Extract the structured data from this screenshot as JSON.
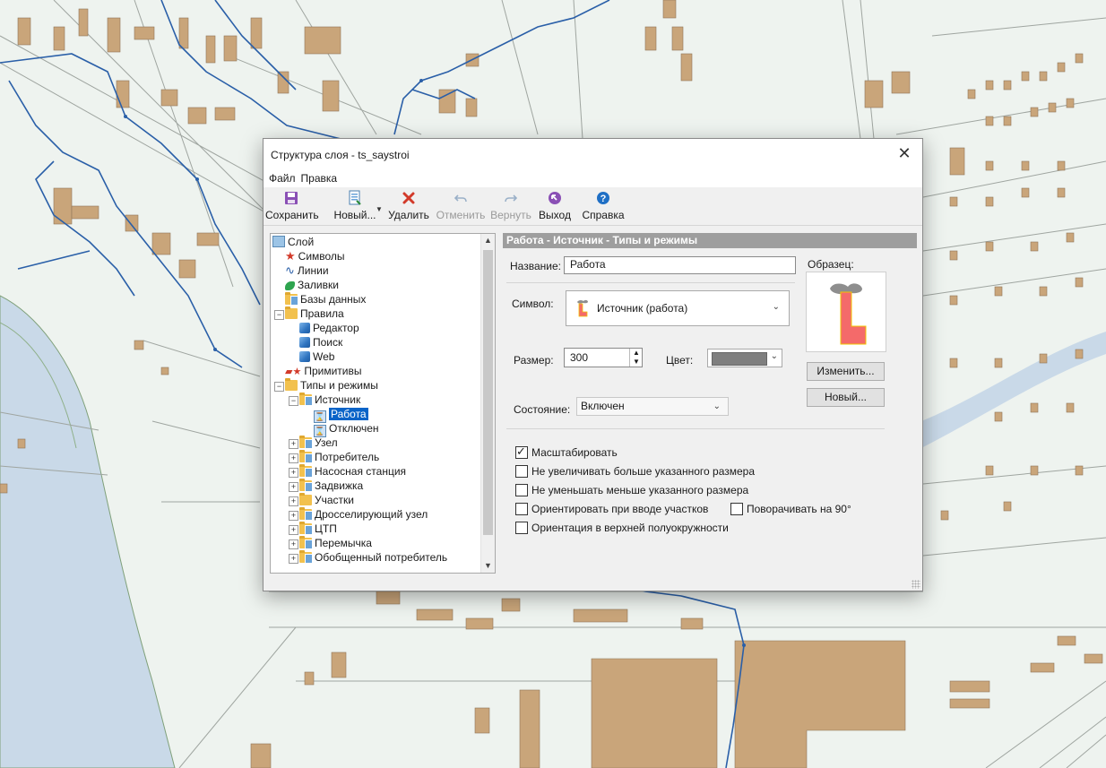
{
  "dialog": {
    "title": "Структура слоя - ts_saystroi",
    "close_glyph": "✕",
    "menu": [
      "Файл",
      "Правка"
    ],
    "toolbar": {
      "save": "Сохранить",
      "new": "Новый...",
      "delete": "Удалить",
      "undo": "Отменить",
      "redo": "Вернуть",
      "exit": "Выход",
      "help": "Справка"
    }
  },
  "tree": {
    "items": [
      {
        "label": "Слой"
      },
      {
        "label": "Символы"
      },
      {
        "label": "Линии"
      },
      {
        "label": "Заливки"
      },
      {
        "label": "Базы данных"
      },
      {
        "label": "Правила"
      },
      {
        "label": "Редактор"
      },
      {
        "label": "Поиск"
      },
      {
        "label": "Web"
      },
      {
        "label": "Примитивы"
      },
      {
        "label": "Типы и режимы"
      },
      {
        "label": "Источник"
      },
      {
        "label": "Работа"
      },
      {
        "label": "Отключен"
      },
      {
        "label": "Узел"
      },
      {
        "label": "Потребитель"
      },
      {
        "label": "Насосная станция"
      },
      {
        "label": "Задвижка"
      },
      {
        "label": "Участки"
      },
      {
        "label": "Дросселирующий узел"
      },
      {
        "label": "ЦТП"
      },
      {
        "label": "Перемычка"
      },
      {
        "label": "Обобщенный потребитель"
      }
    ],
    "selected": "Работа"
  },
  "panel": {
    "header": "Работа - Источник - Типы и режимы",
    "name_label": "Название:",
    "name_value": "Работа",
    "sample_label": "Образец:",
    "symbol_label": "Символ:",
    "symbol_value": "Источник (работа)",
    "size_label": "Размер:",
    "size_value": "300",
    "color_label": "Цвет:",
    "color_value": "#7f7f7f",
    "change_button": "Изменить...",
    "new_button": "Новый...",
    "state_label": "Состояние:",
    "state_value": "Включен",
    "checkboxes": [
      {
        "label": "Масштабировать",
        "checked": true
      },
      {
        "label": "Не увеличивать больше указанного размера",
        "checked": false
      },
      {
        "label": "Не уменьшать меньше указанного размера",
        "checked": false
      },
      {
        "label": "Ориентировать при вводе участков",
        "checked": false
      },
      {
        "label": "Поворачивать на 90°",
        "checked": false
      },
      {
        "label": "Ориентация в верхней полуокружности",
        "checked": false
      }
    ]
  },
  "colors": {
    "map_background": "#eef3ef",
    "building": "#c9a57a",
    "network_line": "#2a5fa8",
    "river": "#c9d9e8",
    "selection": "#0a64c8",
    "header": "#9e9e9e"
  }
}
